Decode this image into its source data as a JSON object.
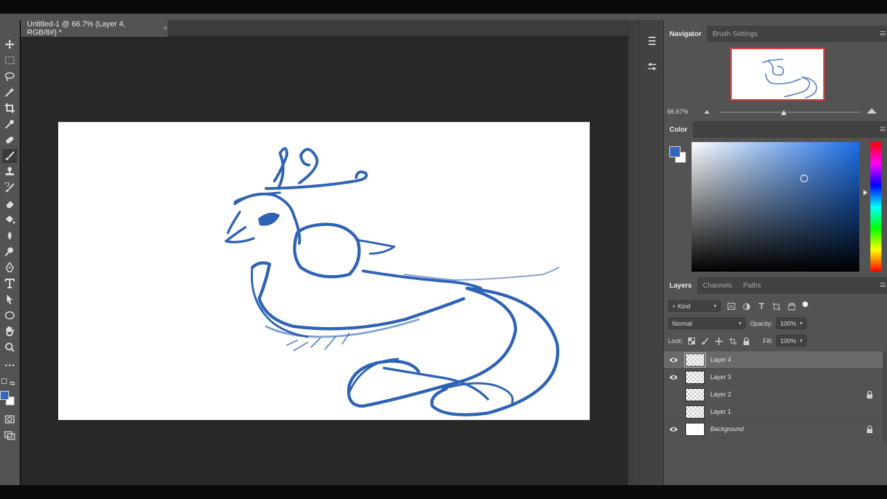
{
  "document": {
    "tab_title": "Untitled-1 @ 66.7% (Layer 4, RGB/8#) *",
    "close_glyph": "×"
  },
  "toolbar": {
    "tools": [
      "move-icon",
      "marquee-icon",
      "lasso-icon",
      "magic-wand-icon",
      "crop-icon",
      "eyedropper-icon",
      "healing-brush-icon",
      "brush-icon",
      "clone-stamp-icon",
      "history-brush-icon",
      "eraser-icon",
      "paint-bucket-icon",
      "blur-icon",
      "dodge-icon",
      "pen-icon",
      "type-icon",
      "path-selection-icon",
      "ellipse-icon",
      "hand-icon",
      "zoom-icon",
      "more-tools-icon"
    ],
    "active_tool": "brush-icon",
    "foreground_color": "#3366bb",
    "background_color": "#ffffff"
  },
  "navigator": {
    "tabs": [
      "Navigator",
      "Brush Settings"
    ],
    "zoom": "66.67%",
    "zoom_fraction": 0.66
  },
  "color": {
    "tab": "Color",
    "foreground": "#3366bb",
    "hue_color": "#1a6ee8"
  },
  "layers": {
    "tabs": [
      "Layers",
      "Channels",
      "Paths"
    ],
    "filter_kind": "Kind",
    "blend_mode": "Normal",
    "opacity_label": "Opacity:",
    "opacity": "100%",
    "lock_label": "Lock:",
    "fill_label": "Fill:",
    "fill": "100%",
    "items": [
      {
        "name": "Layer 4",
        "visible": true,
        "selected": true,
        "locked": false
      },
      {
        "name": "Layer 3",
        "visible": true,
        "selected": false,
        "locked": false
      },
      {
        "name": "Layer 2",
        "visible": false,
        "selected": false,
        "locked": true
      },
      {
        "name": "Layer 1",
        "visible": false,
        "selected": false,
        "locked": false
      },
      {
        "name": "Background",
        "visible": true,
        "selected": false,
        "locked": true
      }
    ]
  },
  "sketch_color": "#2f63b5"
}
